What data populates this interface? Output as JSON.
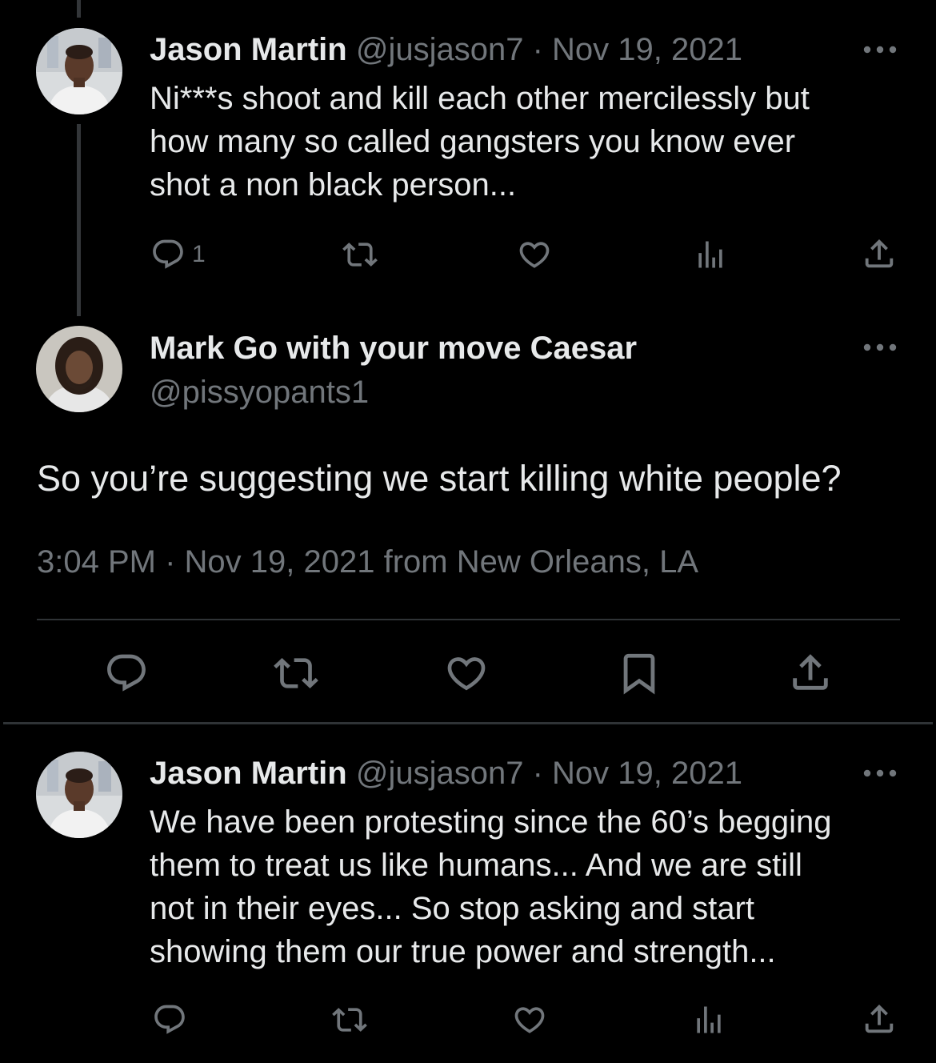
{
  "tweets": [
    {
      "display_name": "Jason Martin",
      "handle": "@jusjason7",
      "separator": "·",
      "date": "Nov 19, 2021",
      "text_lines": [
        "Ni***s shoot and kill each other mercilessly but",
        "how many so called gangsters you know ever",
        "shot a non black person..."
      ],
      "reply_count": "1",
      "icons": [
        "reply-icon",
        "retweet-icon",
        "like-icon",
        "views-icon",
        "share-icon"
      ]
    },
    {
      "display_name": "Jason Martin",
      "handle": "@jusjason7",
      "separator": "·",
      "date": "Nov 19, 2021",
      "text_lines": [
        "We have been protesting since the 60’s begging",
        "them to treat us like humans... And we are still",
        "not in their eyes... So stop asking and start",
        "showing them our true power and strength..."
      ],
      "icons": [
        "reply-icon",
        "retweet-icon",
        "like-icon",
        "views-icon",
        "share-icon"
      ]
    }
  ],
  "main_tweet": {
    "display_name": "Mark Go with your move Caesar",
    "handle": "@pissyopants1",
    "text": "So you’re suggesting we start killing white people?",
    "meta": "3:04 PM · Nov 19, 2021 from New Orleans, LA",
    "icons": [
      "reply-icon",
      "retweet-icon",
      "like-icon",
      "bookmark-icon",
      "share-icon"
    ]
  },
  "colors": {
    "background": "#000000",
    "primary_text": "#e7e9ea",
    "secondary_text": "#71767b",
    "divider": "#2f3336"
  }
}
